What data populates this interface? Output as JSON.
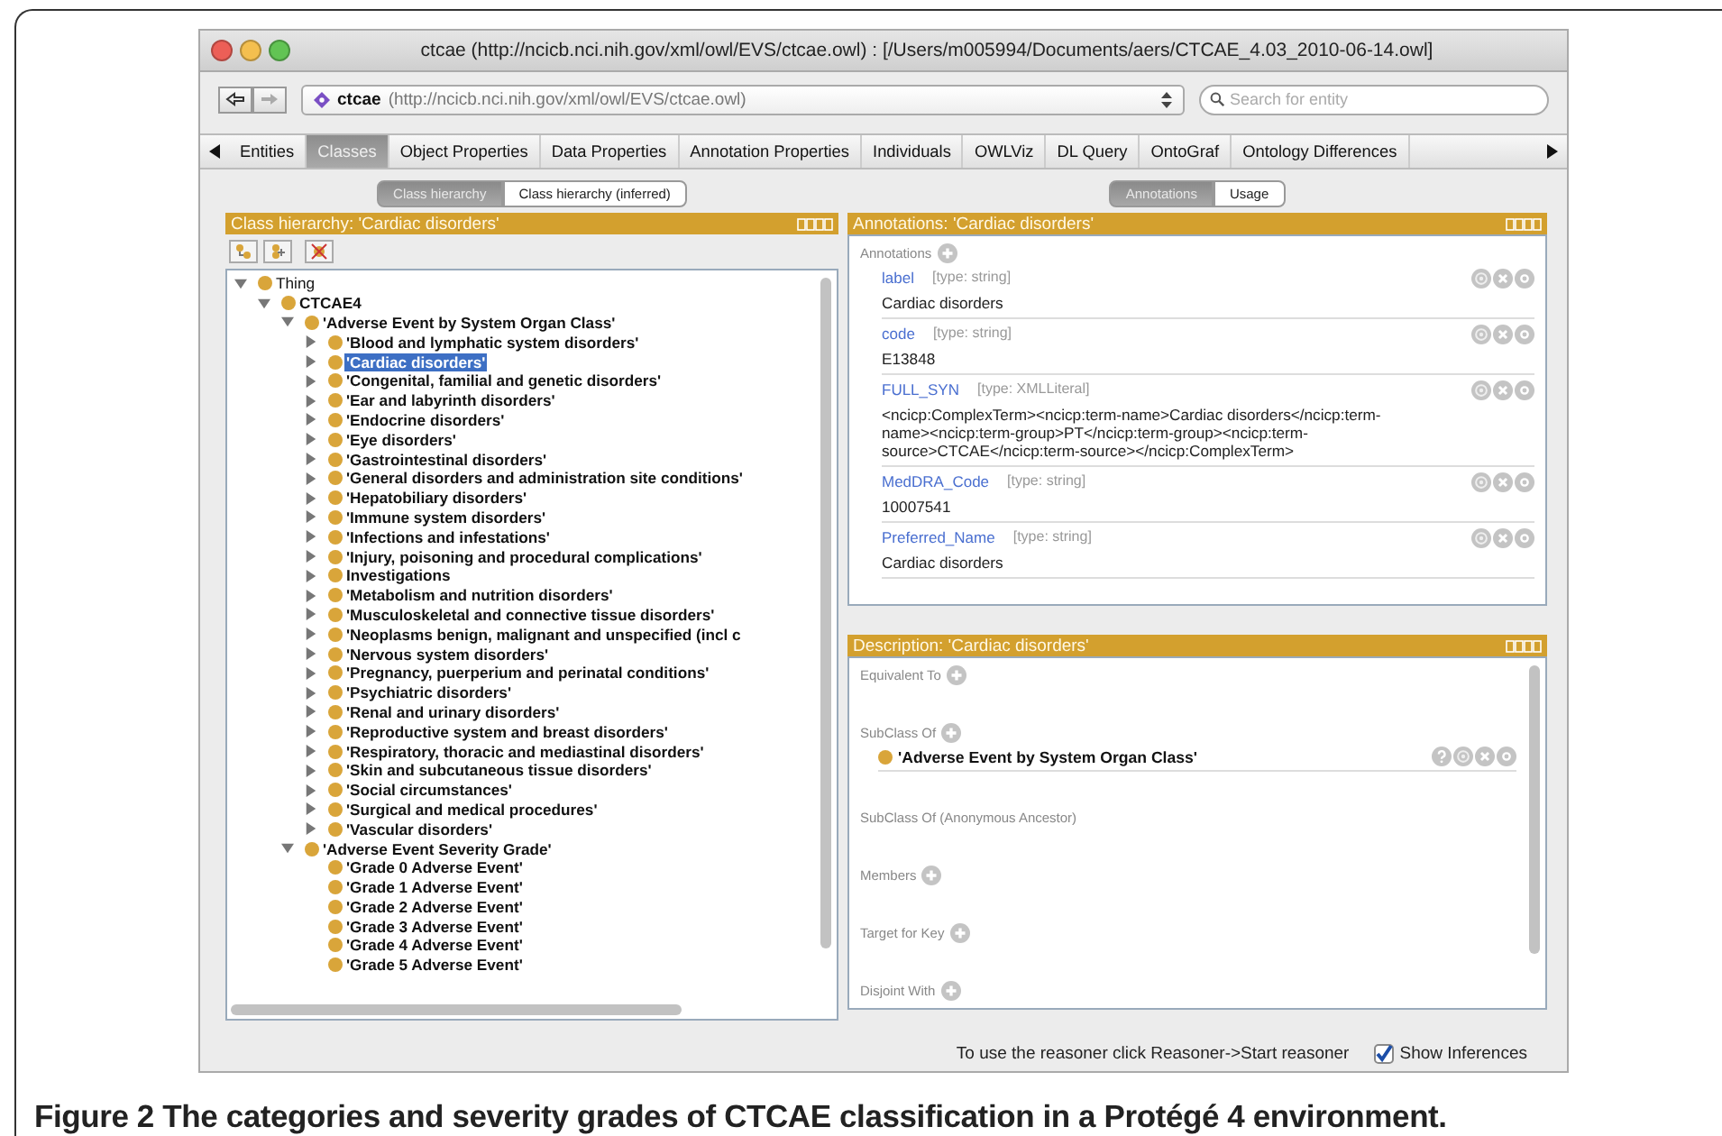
{
  "window": {
    "title": "ctcae (http://ncicb.nci.nih.gov/xml/owl/EVS/ctcae.owl)  : [/Users/m005994/Documents/aers/CTCAE_4.03_2010-06-14.owl]"
  },
  "address": {
    "name": "ctcae",
    "uri": "(http://ncicb.nci.nih.gov/xml/owl/EVS/ctcae.owl)"
  },
  "search": {
    "placeholder": "Search for entity"
  },
  "tabs": [
    {
      "label": "Entities",
      "selected": false
    },
    {
      "label": "Classes",
      "selected": true
    },
    {
      "label": "Object Properties",
      "selected": false
    },
    {
      "label": "Data Properties",
      "selected": false
    },
    {
      "label": "Annotation Properties",
      "selected": false
    },
    {
      "label": "Individuals",
      "selected": false
    },
    {
      "label": "OWLViz",
      "selected": false
    },
    {
      "label": "DL Query",
      "selected": false
    },
    {
      "label": "OntoGraf",
      "selected": false
    },
    {
      "label": "Ontology Differences",
      "selected": false
    }
  ],
  "class_hierarchy": {
    "view_tabs": [
      {
        "label": "Class hierarchy",
        "selected": true
      },
      {
        "label": "Class hierarchy (inferred)",
        "selected": false
      }
    ],
    "title": "Class hierarchy: 'Cardiac disorders'",
    "tree": [
      {
        "label": "Thing",
        "bold": false,
        "expanded": true,
        "selected": false,
        "children": [
          {
            "label": "CTCAE4",
            "bold": true,
            "expanded": true,
            "selected": false,
            "children": [
              {
                "label": "'Adverse Event by System Organ Class'",
                "bold": true,
                "expanded": true,
                "selected": false,
                "children": [
                  {
                    "label": "'Blood and lymphatic system disorders'",
                    "bold": true,
                    "expanded": false,
                    "selected": false
                  },
                  {
                    "label": "'Cardiac disorders'",
                    "bold": true,
                    "expanded": false,
                    "selected": true
                  },
                  {
                    "label": "'Congenital, familial and genetic disorders'",
                    "bold": true,
                    "expanded": false,
                    "selected": false
                  },
                  {
                    "label": "'Ear and labyrinth disorders'",
                    "bold": true,
                    "expanded": false,
                    "selected": false
                  },
                  {
                    "label": "'Endocrine disorders'",
                    "bold": true,
                    "expanded": false,
                    "selected": false
                  },
                  {
                    "label": "'Eye disorders'",
                    "bold": true,
                    "expanded": false,
                    "selected": false
                  },
                  {
                    "label": "'Gastrointestinal disorders'",
                    "bold": true,
                    "expanded": false,
                    "selected": false
                  },
                  {
                    "label": "'General disorders and administration site conditions'",
                    "bold": true,
                    "expanded": false,
                    "selected": false
                  },
                  {
                    "label": "'Hepatobiliary disorders'",
                    "bold": true,
                    "expanded": false,
                    "selected": false
                  },
                  {
                    "label": "'Immune system disorders'",
                    "bold": true,
                    "expanded": false,
                    "selected": false
                  },
                  {
                    "label": "'Infections and infestations'",
                    "bold": true,
                    "expanded": false,
                    "selected": false
                  },
                  {
                    "label": "'Injury, poisoning and procedural complications'",
                    "bold": true,
                    "expanded": false,
                    "selected": false
                  },
                  {
                    "label": "Investigations",
                    "bold": true,
                    "expanded": false,
                    "selected": false
                  },
                  {
                    "label": "'Metabolism and nutrition disorders'",
                    "bold": true,
                    "expanded": false,
                    "selected": false
                  },
                  {
                    "label": "'Musculoskeletal and connective tissue disorders'",
                    "bold": true,
                    "expanded": false,
                    "selected": false
                  },
                  {
                    "label": "'Neoplasms benign, malignant and unspecified (incl c",
                    "bold": true,
                    "expanded": false,
                    "selected": false
                  },
                  {
                    "label": "'Nervous system disorders'",
                    "bold": true,
                    "expanded": false,
                    "selected": false
                  },
                  {
                    "label": "'Pregnancy, puerperium and perinatal conditions'",
                    "bold": true,
                    "expanded": false,
                    "selected": false
                  },
                  {
                    "label": "'Psychiatric disorders'",
                    "bold": true,
                    "expanded": false,
                    "selected": false
                  },
                  {
                    "label": "'Renal and urinary disorders'",
                    "bold": true,
                    "expanded": false,
                    "selected": false
                  },
                  {
                    "label": "'Reproductive system and breast disorders'",
                    "bold": true,
                    "expanded": false,
                    "selected": false
                  },
                  {
                    "label": "'Respiratory, thoracic and mediastinal disorders'",
                    "bold": true,
                    "expanded": false,
                    "selected": false
                  },
                  {
                    "label": "'Skin and subcutaneous tissue disorders'",
                    "bold": true,
                    "expanded": false,
                    "selected": false
                  },
                  {
                    "label": "'Social circumstances'",
                    "bold": true,
                    "expanded": false,
                    "selected": false
                  },
                  {
                    "label": "'Surgical and medical procedures'",
                    "bold": true,
                    "expanded": false,
                    "selected": false
                  },
                  {
                    "label": "'Vascular disorders'",
                    "bold": true,
                    "expanded": false,
                    "selected": false
                  }
                ]
              },
              {
                "label": "'Adverse Event Severity Grade'",
                "bold": true,
                "expanded": true,
                "selected": false,
                "children": [
                  {
                    "label": "'Grade 0 Adverse Event'",
                    "bold": true,
                    "selected": false
                  },
                  {
                    "label": "'Grade 1 Adverse Event'",
                    "bold": true,
                    "selected": false
                  },
                  {
                    "label": "'Grade 2 Adverse Event'",
                    "bold": true,
                    "selected": false
                  },
                  {
                    "label": "'Grade 3 Adverse Event'",
                    "bold": true,
                    "selected": false
                  },
                  {
                    "label": "'Grade 4 Adverse Event'",
                    "bold": true,
                    "selected": false
                  },
                  {
                    "label": "'Grade 5 Adverse Event'",
                    "bold": true,
                    "selected": false
                  }
                ]
              }
            ]
          }
        ]
      }
    ]
  },
  "annotations_panel": {
    "view_tabs": [
      {
        "label": "Annotations",
        "selected": true
      },
      {
        "label": "Usage",
        "selected": false
      }
    ],
    "title": "Annotations: 'Cardiac disorders'",
    "section_label": "Annotations",
    "items": [
      {
        "property": "label",
        "type": "[type: string]",
        "value": "Cardiac disorders"
      },
      {
        "property": "code",
        "type": "[type: string]",
        "value": "E13848"
      },
      {
        "property": "FULL_SYN",
        "type": "[type: XMLLiteral]",
        "value": "<ncicp:ComplexTerm><ncicp:term-name>Cardiac disorders</ncicp:term-name><ncicp:term-group>PT</ncicp:term-group><ncicp:term-source>CTCAE</ncicp:term-source></ncicp:ComplexTerm>"
      },
      {
        "property": "MedDRA_Code",
        "type": "[type: string]",
        "value": "10007541"
      },
      {
        "property": "Preferred_Name",
        "type": "[type: string]",
        "value": "Cardiac disorders"
      }
    ]
  },
  "description_panel": {
    "title": "Description: 'Cardiac disorders'",
    "sections": [
      {
        "label": "Equivalent To",
        "add_button": true
      },
      {
        "label": "SubClass Of",
        "add_button": true,
        "items": [
          "'Adverse Event by System Organ Class'"
        ]
      },
      {
        "label": "SubClass Of (Anonymous Ancestor)",
        "add_button": false
      },
      {
        "label": "Members",
        "add_button": true
      },
      {
        "label": "Target for Key",
        "add_button": true
      },
      {
        "label": "Disjoint With",
        "add_button": true
      }
    ]
  },
  "status_bar": {
    "message": "To use the reasoner click Reasoner->Start reasoner",
    "show_inferences": {
      "label": "Show Inferences",
      "checked": true
    }
  },
  "caption": {
    "label": "Figure 2",
    "text": "The categories and severity grades of CTCAE classification in a Protégé 4 environment."
  }
}
